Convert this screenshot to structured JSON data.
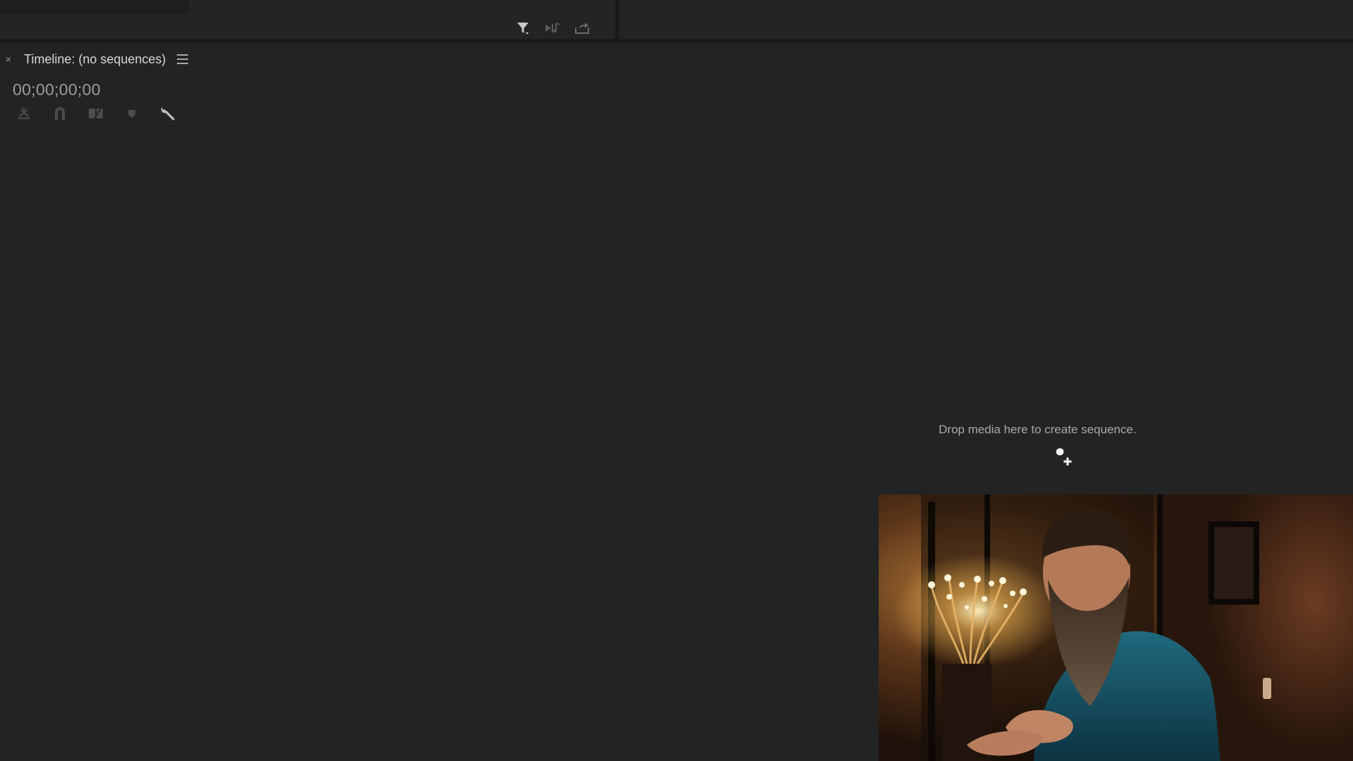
{
  "app": {
    "timeline_panel": {
      "close_label": "×",
      "title": "Timeline: (no sequences)",
      "timecode": "00;00;00;00",
      "empty_message": "Drop media here to create sequence."
    },
    "top_toolbar_icons": [
      "filter-icon",
      "insert-audio-icon",
      "export-icon"
    ],
    "timeline_tool_icons": [
      "nest-sequence-icon",
      "snap-magnet-icon",
      "linked-selection-icon",
      "add-marker-icon",
      "wrench-settings-icon"
    ]
  },
  "colors": {
    "background": "#232323",
    "divider": "#1a1a1a",
    "text": "#d8d8d8",
    "dim_text": "#9c9c9c"
  }
}
